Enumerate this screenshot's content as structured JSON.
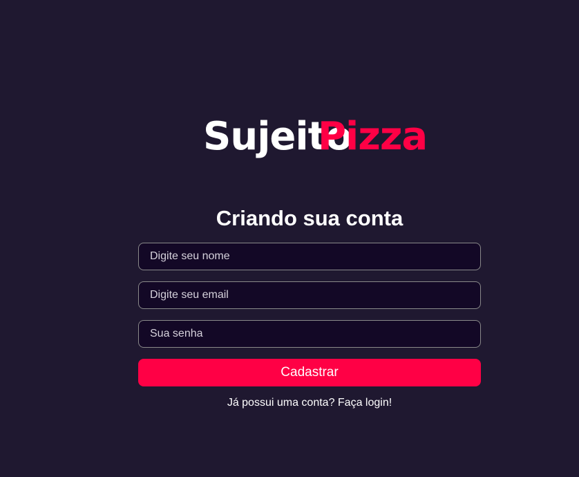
{
  "colors": {
    "background": "#1f1830",
    "input_background": "#130826",
    "input_border": "#8a8a8a",
    "accent": "#ff0045",
    "text": "#ffffff"
  },
  "logo": {
    "part1": "Sujeito",
    "part2": "Pizza"
  },
  "form": {
    "title": "Criando sua conta",
    "name_placeholder": "Digite seu nome",
    "name_value": "",
    "email_placeholder": "Digite seu email",
    "email_value": "",
    "password_placeholder": "Sua senha",
    "password_value": "",
    "submit_label": "Cadastrar",
    "login_link": "Já possui uma conta? Faça login!"
  }
}
